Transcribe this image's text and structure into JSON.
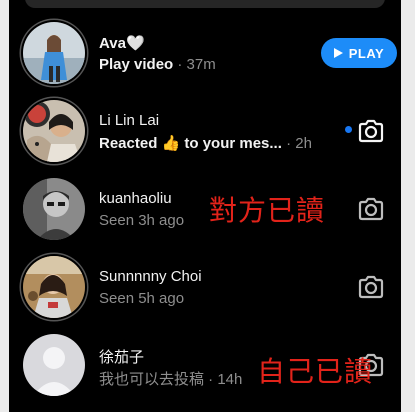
{
  "threads": [
    {
      "name": "Ava🤍",
      "subtitle_strong": "Play video",
      "subtitle_time": "· 37m",
      "action_label": "PLAY"
    },
    {
      "name": "Li Lin Lai",
      "subtitle_strong": "Reacted 👍 to your mes...",
      "subtitle_time": "· 2h",
      "unread": true
    },
    {
      "name": "kuanhaoliu",
      "subtitle": "Seen 3h ago"
    },
    {
      "name": "Sunnnnny Choi",
      "subtitle": "Seen 5h ago"
    },
    {
      "name": "徐茄子",
      "subtitle": "我也可以去投稿 · 14h"
    }
  ],
  "annotations": {
    "other_read": "對方已讀",
    "self_read": "自己已讀"
  },
  "colors": {
    "background": "#000000",
    "accent_blue": "#1d8cf8",
    "annotation_red": "#e2231a"
  },
  "icons": [
    "camera-icon",
    "play-icon",
    "unread-dot"
  ]
}
